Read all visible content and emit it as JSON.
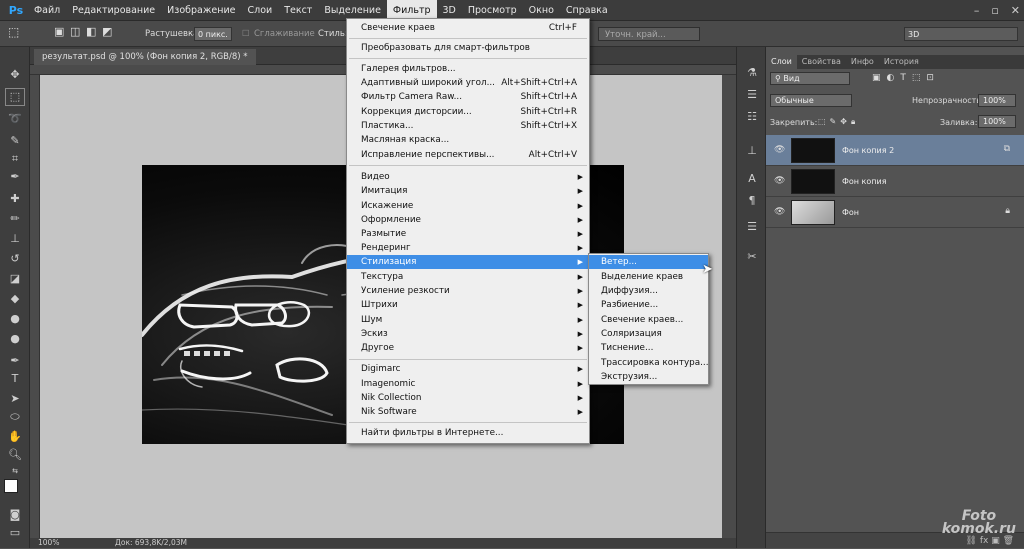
{
  "app": {
    "logo": "Ps",
    "menus": [
      "Файл",
      "Редактирование",
      "Изображение",
      "Слои",
      "Текст",
      "Выделение",
      "Фильтр",
      "3D",
      "Просмотр",
      "Окно",
      "Справка"
    ],
    "active_menu": "Фильтр",
    "window_controls": [
      "–",
      "▫",
      "✕"
    ]
  },
  "options": {
    "feather_label": "Растушевка:",
    "feather_value": "0 пикс.",
    "antialias_label": "Сглаживание",
    "style_label": "Стиль:",
    "refine_button": "Уточн. край...",
    "workspace": "3D"
  },
  "document": {
    "tab_title": "результат.psd @ 100% (Фон копия 2, RGB/8) *",
    "zoom": "100%",
    "doc_info": "Док: 693,8K/2,03M"
  },
  "filter_menu": {
    "items": [
      {
        "label": "Свечение краев",
        "shortcut": "Ctrl+F"
      },
      {
        "label": "Преобразовать для смарт-фильтров",
        "shortcut": ""
      },
      {
        "label": "Галерея фильтров...",
        "shortcut": ""
      },
      {
        "label": "Адаптивный широкий угол...",
        "shortcut": "Alt+Shift+Ctrl+A"
      },
      {
        "label": "Фильтр Camera Raw...",
        "shortcut": "Shift+Ctrl+A"
      },
      {
        "label": "Коррекция дисторсии...",
        "shortcut": "Shift+Ctrl+R"
      },
      {
        "label": "Пластика...",
        "shortcut": "Shift+Ctrl+X"
      },
      {
        "label": "Масляная краска...",
        "shortcut": ""
      },
      {
        "label": "Исправление перспективы...",
        "shortcut": "Alt+Ctrl+V"
      },
      {
        "label": "Видео",
        "shortcut": ""
      },
      {
        "label": "Имитация",
        "shortcut": ""
      },
      {
        "label": "Искажение",
        "shortcut": ""
      },
      {
        "label": "Оформление",
        "shortcut": ""
      },
      {
        "label": "Размытие",
        "shortcut": ""
      },
      {
        "label": "Рендеринг",
        "shortcut": ""
      },
      {
        "label": "Стилизация",
        "shortcut": ""
      },
      {
        "label": "Текстура",
        "shortcut": ""
      },
      {
        "label": "Усиление резкости",
        "shortcut": ""
      },
      {
        "label": "Штрихи",
        "shortcut": ""
      },
      {
        "label": "Шум",
        "shortcut": ""
      },
      {
        "label": "Эскиз",
        "shortcut": ""
      },
      {
        "label": "Другое",
        "shortcut": ""
      },
      {
        "label": "Digimarc",
        "shortcut": ""
      },
      {
        "label": "Imagenomic",
        "shortcut": ""
      },
      {
        "label": "Nik Collection",
        "shortcut": ""
      },
      {
        "label": "Nik Software",
        "shortcut": ""
      },
      {
        "label": "Найти фильтры в Интернете...",
        "shortcut": ""
      }
    ],
    "highlighted": "Стилизация"
  },
  "stylize_submenu": {
    "items": [
      "Ветер...",
      "Выделение краев",
      "Диффузия...",
      "Разбиение...",
      "Свечение краев...",
      "Соляризация",
      "Тиснение...",
      "Трассировка контура...",
      "Экструзия..."
    ],
    "highlighted": "Ветер..."
  },
  "layers_panel": {
    "tabs": [
      "Слои",
      "Свойства",
      "Инфо",
      "История"
    ],
    "active_tab": "Слои",
    "filter_kind": "Вид",
    "blend_mode": "Обычные",
    "opacity_label": "Непрозрачность:",
    "opacity_value": "100%",
    "lock_label": "Закрепить:",
    "fill_label": "Заливка:",
    "fill_value": "100%",
    "layers": [
      {
        "name": "Фон копия 2",
        "selected": true
      },
      {
        "name": "Фон копия",
        "selected": false
      },
      {
        "name": "Фон",
        "selected": false,
        "locked": true
      }
    ]
  },
  "watermark": {
    "line1": "Foto",
    "line2": "komok.ru"
  },
  "colors": {
    "menu_highlight": "#3e8ee6",
    "layer_selected": "#6a7f9a",
    "ps_blue": "#31a8ff"
  }
}
